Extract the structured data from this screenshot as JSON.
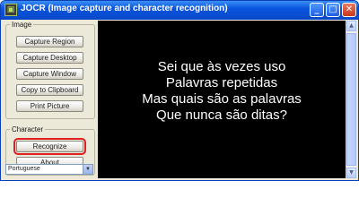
{
  "window": {
    "title": "JOCR (Image capture and character recognition)",
    "icon": "app-icon",
    "controls": {
      "minimize": "_",
      "maximize": "□",
      "close": "✕"
    }
  },
  "image_group": {
    "legend": "Image",
    "buttons": [
      "Capture Region",
      "Capture Desktop",
      "Capture Window",
      "Copy to Clipboard",
      "Print Picture"
    ]
  },
  "character_group": {
    "legend": "Character",
    "buttons": [
      "Recognize",
      "About"
    ]
  },
  "language": {
    "selected": "Portuguese"
  },
  "image_text": {
    "lines": [
      "Sei que às vezes uso",
      "Palavras repetidas",
      "Mas quais são as palavras",
      "Que nunca são ditas?"
    ]
  },
  "colors": {
    "highlight": "#e0201f",
    "titlebar": "#0a55de",
    "image_bg": "#000000"
  }
}
